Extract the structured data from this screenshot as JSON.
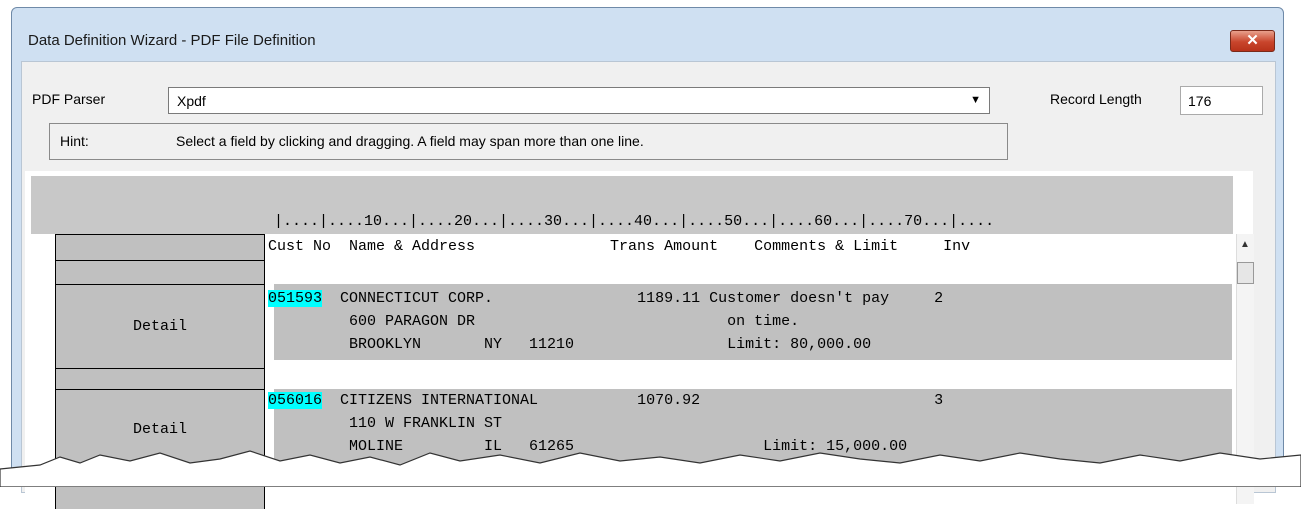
{
  "window": {
    "title": "Data Definition Wizard - PDF File Definition",
    "close_label": "✕"
  },
  "form": {
    "parser_label": "PDF Parser",
    "parser_value": "Xpdf",
    "record_length_label": "Record Length",
    "record_length_value": "176",
    "hint_label": "Hint:",
    "hint_text": "Select a field by clicking and dragging. A field may span more than one line."
  },
  "ruler": "|....|....10...|....20...|....30...|....40...|....50...|....60...|....70...|....",
  "header_line": "Cust No  Name & Address               Trans Amount    Comments & Limit     Inv",
  "records": [
    {
      "label": "Detail",
      "cust_no": "051593",
      "line1": "  CONNECTICUT CORP.                1189.11 Customer doesn't pay     2",
      "line2": "         600 PARAGON DR                            on time.",
      "line3": "         BROOKLYN       NY   11210                 Limit: 80,000.00"
    },
    {
      "label": "Detail",
      "cust_no": "056016",
      "line1": "  CITIZENS INTERNATIONAL           1070.92                          3",
      "line2": "         110 W FRANKLIN ST",
      "line3": "         MOLINE         IL   61265                     Limit: 15,000.00"
    }
  ]
}
